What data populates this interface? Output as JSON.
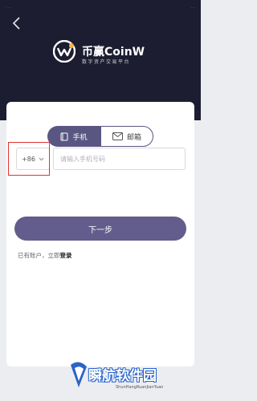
{
  "status_bar": {
    "left": "...",
    "right": "..."
  },
  "header": {
    "brand": "币赢CoinW",
    "tagline": "数字资产交易平台"
  },
  "tabs": [
    {
      "label": "手机",
      "icon": "book-icon",
      "active": true
    },
    {
      "label": "邮箱",
      "icon": "envelope-icon",
      "active": false
    }
  ],
  "phone": {
    "country_code": "+86",
    "placeholder": "请输入手机号码",
    "value": ""
  },
  "next_button": "下一步",
  "login_prompt": {
    "text": "已有账户，立即",
    "link": "登录"
  },
  "watermark": {
    "title": "瞬航软件园",
    "subtitle": "ShunHangRuanJianYuan"
  },
  "colors": {
    "header_bg": "#1d1d31",
    "accent": "#5a5682",
    "highlight": "#e3322f"
  }
}
